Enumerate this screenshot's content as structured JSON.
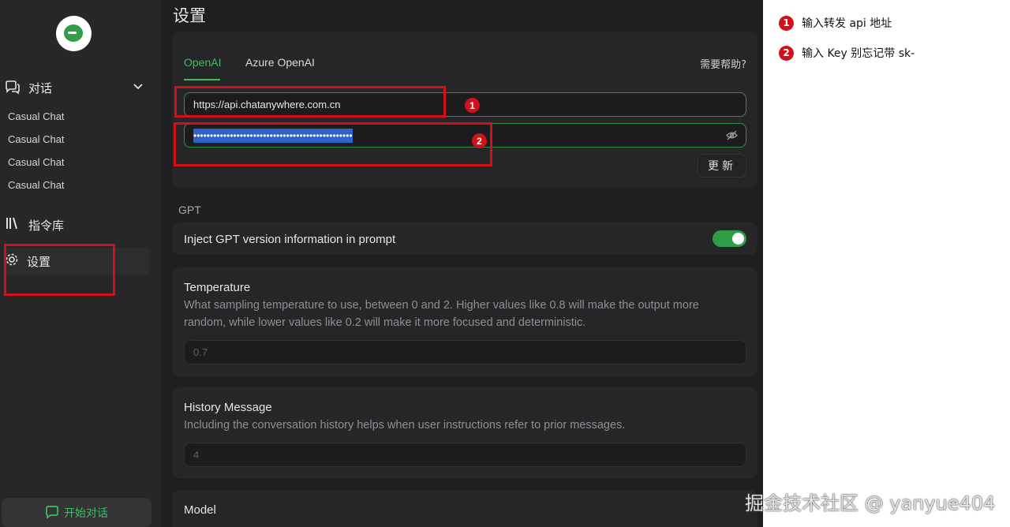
{
  "sidebar": {
    "chat_label": "对话",
    "chats": [
      "Casual Chat",
      "Casual Chat",
      "Casual Chat",
      "Casual Chat"
    ],
    "library_label": "指令库",
    "settings_label": "设置",
    "start_button": "开始对话"
  },
  "main": {
    "title": "设置",
    "tabs": [
      "OpenAI",
      "Azure OpenAI"
    ],
    "help": "需要帮助?",
    "api_url": "https://api.chatanywhere.com.cn",
    "api_key_masked": "••••••••••••••••••••••••••••••••••••••••••••••••",
    "update_button": "更新",
    "section_gpt": "GPT",
    "inject_label": "Inject GPT version information in prompt",
    "inject_enabled": true,
    "temperature": {
      "title": "Temperature",
      "description": "What sampling temperature to use, between 0 and 2. Higher values like 0.8 will make the output more random, while lower values like 0.2 will make it more focused and deterministic.",
      "value": "0.7"
    },
    "history": {
      "title": "History Message",
      "description": "Including the conversation history helps when user instructions refer to prior messages.",
      "value": "4"
    },
    "model": {
      "title": "Model"
    }
  },
  "annotations": {
    "badge1": "1",
    "badge2": "2",
    "note1": "输入转发 api 地址",
    "note2": "输入 Key 别忘记带 sk-"
  },
  "watermark": "掘金技术社区 @ yanyue404",
  "colors": {
    "accent": "#3bbf5a",
    "annotation": "#d0101a",
    "selection": "#2f62c8"
  }
}
